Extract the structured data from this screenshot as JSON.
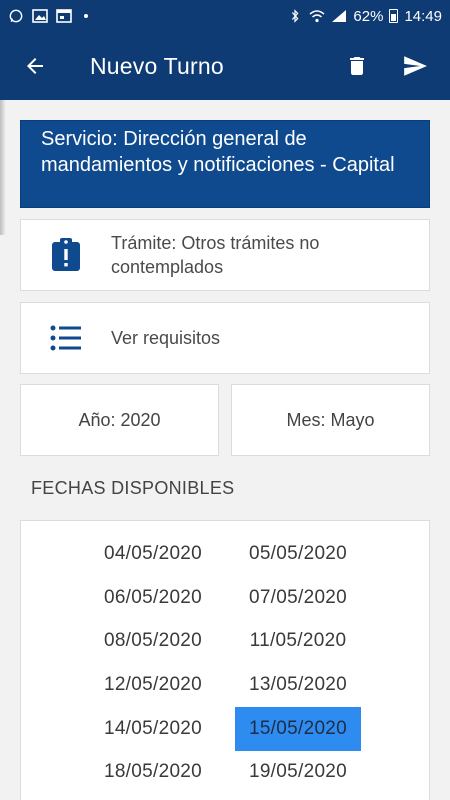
{
  "status_bar": {
    "battery": "62%",
    "time": "14:49"
  },
  "app_bar": {
    "title": "Nuevo Turno"
  },
  "service": {
    "text": "Servicio: Dirección general de mandamientos y notificaciones - Capital"
  },
  "tramite": {
    "text": "Trámite: Otros trámites no contemplados"
  },
  "requisitos": {
    "text": "Ver requisitos"
  },
  "filters": {
    "year": "Año: 2020",
    "month": "Mes: Mayo"
  },
  "dates_section": {
    "title": "FECHAS DISPONIBLES",
    "selected": "15/05/2020",
    "selected_color": "#2e8cf0",
    "dates": [
      "04/05/2020",
      "05/05/2020",
      "06/05/2020",
      "07/05/2020",
      "08/05/2020",
      "11/05/2020",
      "12/05/2020",
      "13/05/2020",
      "14/05/2020",
      "15/05/2020",
      "18/05/2020",
      "19/05/2020"
    ]
  },
  "colors": {
    "primary": "#0e3b73",
    "service_bg": "#0f4a8f",
    "icon": "#0f4a8f"
  }
}
